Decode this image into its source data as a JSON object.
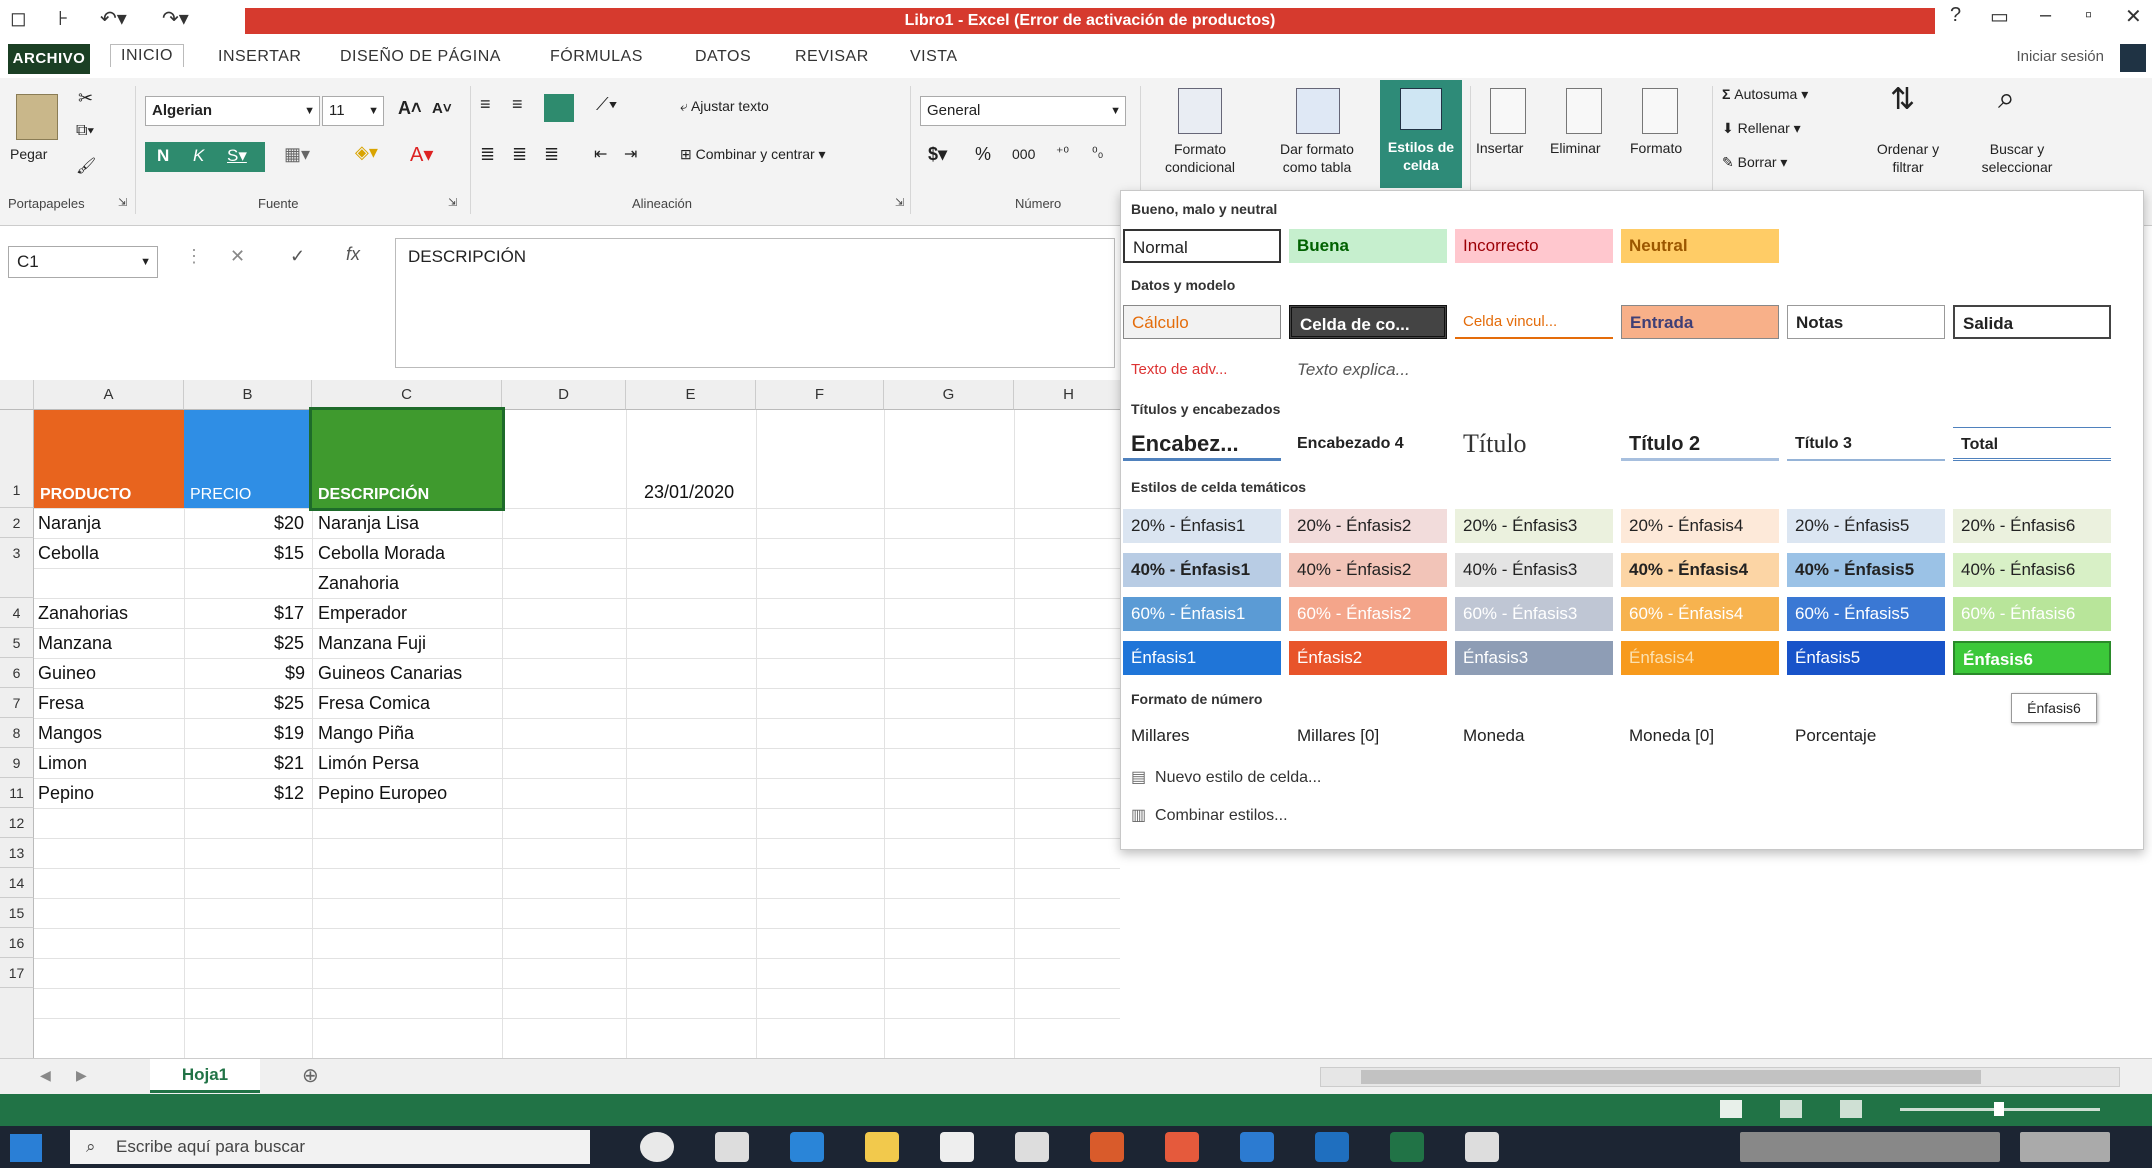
{
  "window": {
    "title": "Libro1 - Excel (Error de activación de productos)"
  },
  "ribbon_tabs": [
    "ARCHIVO",
    "INICIO",
    "INSERTAR",
    "DISEÑO DE PÁGINA",
    "FÓRMULAS",
    "DATOS",
    "REVISAR",
    "VISTA"
  ],
  "tell_me": "Iniciar sesión",
  "ribbon": {
    "clipboard": {
      "paste": "Pegar",
      "label": "Portapapeles"
    },
    "font": {
      "name": "Algerian",
      "size": "11",
      "label": "Fuente"
    },
    "alignment": {
      "wrap": "Ajustar texto",
      "merge": "Combinar y centrar",
      "label": "Alineación"
    },
    "number": {
      "format": "General",
      "label": "Número"
    },
    "styles": {
      "conditional": "Formato condicional",
      "as_table": "Dar formato como tabla",
      "cell_styles": "Estilos de celda"
    },
    "cells": {
      "insert": "Insertar",
      "delete": "Eliminar",
      "format": "Formato"
    },
    "editing": {
      "autosum": "Autosuma",
      "fill": "Rellenar",
      "clear": "Borrar",
      "sort": "Ordenar y filtrar",
      "find": "Buscar y seleccionar"
    }
  },
  "formula_bar": {
    "name_box": "C1",
    "content": "DESCRIPCIÓN"
  },
  "columns": [
    "A",
    "B",
    "C",
    "D",
    "E",
    "F",
    "G",
    "H"
  ],
  "rows": [
    "1",
    "2",
    "3",
    "4",
    "5",
    "6",
    "7",
    "8",
    "9",
    "11",
    "12",
    "13",
    "14",
    "15",
    "16",
    "17"
  ],
  "headers": {
    "a": "PRODUCTO",
    "b": "PRECIO",
    "c": "DESCRIPCIÓN",
    "date": "23/01/2020"
  },
  "table": [
    {
      "product": "Naranja",
      "price": "$20",
      "desc": "Naranja Lisa"
    },
    {
      "product": "Cebolla",
      "price": "$15",
      "desc": "Cebolla Morada"
    },
    {
      "product": "",
      "price": "",
      "desc": "Zanahoria"
    },
    {
      "product": "Zanahorias",
      "price": "$17",
      "desc": "Emperador"
    },
    {
      "product": "Manzana",
      "price": "$25",
      "desc": "Manzana Fuji"
    },
    {
      "product": "Guineo",
      "price": "$9",
      "desc": "Guineos Canarias"
    },
    {
      "product": "Fresa",
      "price": "$25",
      "desc": "Fresa Comica"
    },
    {
      "product": "Mangos",
      "price": "$19",
      "desc": "Mango Piña"
    },
    {
      "product": "Limon",
      "price": "$21",
      "desc": "Limón Persa"
    },
    {
      "product": "Pepino",
      "price": "$12",
      "desc": "Pepino Europeo"
    }
  ],
  "sheet_tab": "Hoja1",
  "taskbar": {
    "search": "Escribe aquí para buscar"
  },
  "gallery": {
    "sections": {
      "good_bad": "Bueno, malo y neutral",
      "data_model": "Datos y modelo",
      "titles": "Títulos y encabezados",
      "themed": "Estilos de celda temáticos",
      "number_format": "Formato de número"
    },
    "good_bad": [
      "Normal",
      "Buena",
      "Incorrecto",
      "Neutral"
    ],
    "data_model_row1": [
      "Cálculo",
      "Celda de co...",
      "Celda vincul...",
      "Entrada",
      "Notas",
      "Salida"
    ],
    "data_model_row2": [
      "Texto de adv...",
      "Texto explica..."
    ],
    "titles": [
      "Encabez...",
      "Encabezado 4",
      "Título",
      "Título 2",
      "Título 3",
      "Total"
    ],
    "themed_20": [
      "20% - Énfasis1",
      "20% - Énfasis2",
      "20% - Énfasis3",
      "20% - Énfasis4",
      "20% - Énfasis5",
      "20% - Énfasis6"
    ],
    "themed_40": [
      "40% - Énfasis1",
      "40% - Énfasis2",
      "40% - Énfasis3",
      "40% - Énfasis4",
      "40% - Énfasis5",
      "40% - Énfasis6"
    ],
    "themed_60": [
      "60% - Énfasis1",
      "60% - Énfasis2",
      "60% - Énfasis3",
      "60% - Énfasis4",
      "60% - Énfasis5",
      "60% - Énfasis6"
    ],
    "accent": [
      "Énfasis1",
      "Énfasis2",
      "Énfasis3",
      "Énfasis4",
      "Énfasis5",
      "Énfasis6"
    ],
    "number_formats": [
      "Millares",
      "Millares [0]",
      "Moneda",
      "Moneda [0]",
      "Porcentaje"
    ],
    "tooltip": "Énfasis6",
    "new_style": "Nuevo estilo de celda...",
    "merge_styles": "Combinar estilos..."
  },
  "colors": {
    "title_red": "#d63a2e",
    "excel_green": "#217346",
    "hdr_orange": "#e8641e",
    "hdr_blue": "#2f8ee5",
    "hdr_green": "#3f9a2e"
  }
}
